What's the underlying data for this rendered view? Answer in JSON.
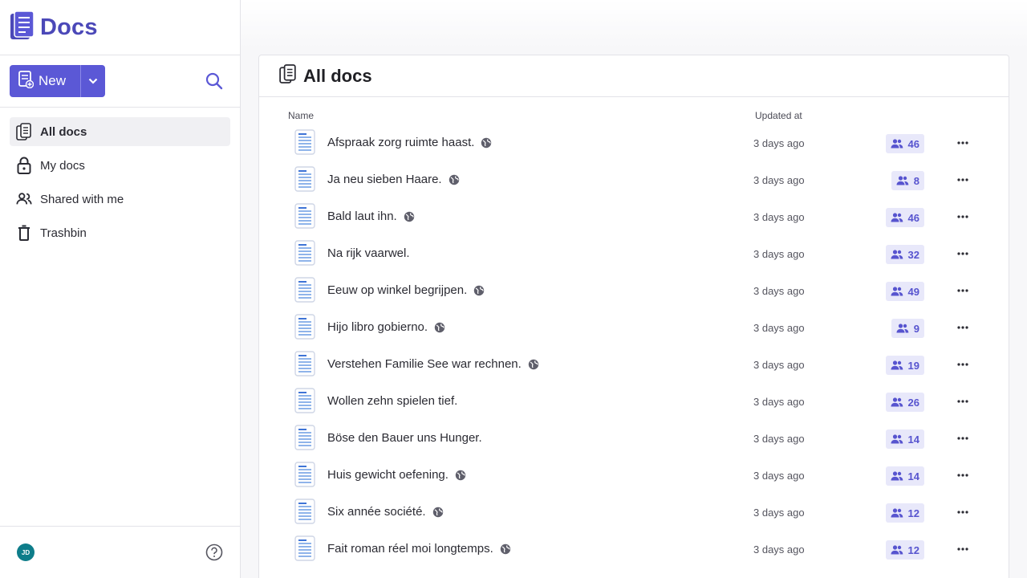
{
  "app": {
    "name": "Docs"
  },
  "toolbar": {
    "new_label": "New"
  },
  "sidebar": {
    "items": [
      {
        "label": "All docs",
        "icon": "documents-icon",
        "active": true
      },
      {
        "label": "My docs",
        "icon": "lock-icon",
        "active": false
      },
      {
        "label": "Shared with me",
        "icon": "people-icon",
        "active": false
      },
      {
        "label": "Trashbin",
        "icon": "trash-icon",
        "active": false
      }
    ],
    "user_initials": "JD"
  },
  "main": {
    "title": "All docs",
    "columns": {
      "name": "Name",
      "updated": "Updated at"
    },
    "docs": [
      {
        "title": "Afspraak zorg ruimte haast.",
        "updated": "3 days ago",
        "members": "46",
        "public": true
      },
      {
        "title": "Ja neu sieben Haare.",
        "updated": "3 days ago",
        "members": "8",
        "public": true
      },
      {
        "title": "Bald laut ihn.",
        "updated": "3 days ago",
        "members": "46",
        "public": true
      },
      {
        "title": "Na rijk vaarwel.",
        "updated": "3 days ago",
        "members": "32",
        "public": false
      },
      {
        "title": "Eeuw op winkel begrijpen.",
        "updated": "3 days ago",
        "members": "49",
        "public": true
      },
      {
        "title": "Hijo libro gobierno.",
        "updated": "3 days ago",
        "members": "9",
        "public": true
      },
      {
        "title": "Verstehen Familie See war rechnen.",
        "updated": "3 days ago",
        "members": "19",
        "public": true
      },
      {
        "title": "Wollen zehn spielen tief.",
        "updated": "3 days ago",
        "members": "26",
        "public": false
      },
      {
        "title": "Böse den Bauer uns Hunger.",
        "updated": "3 days ago",
        "members": "14",
        "public": false
      },
      {
        "title": "Huis gewicht oefening.",
        "updated": "3 days ago",
        "members": "14",
        "public": true
      },
      {
        "title": "Six année société.",
        "updated": "3 days ago",
        "members": "12",
        "public": true
      },
      {
        "title": "Fait roman réel moi longtemps.",
        "updated": "3 days ago",
        "members": "12",
        "public": true
      }
    ]
  },
  "colors": {
    "brand": "#4b48b8",
    "accent": "#5b58d6",
    "badge_bg": "#e8e8fa",
    "avatar": "#0e7d8a"
  }
}
